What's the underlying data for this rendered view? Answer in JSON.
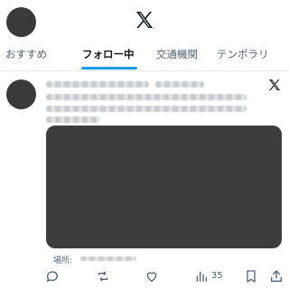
{
  "header": {
    "logo_icon": "x-logo-icon"
  },
  "tabs": [
    {
      "label": "おすすめ",
      "active": false
    },
    {
      "label": "フォロー中",
      "active": true
    },
    {
      "label": "交通機関",
      "active": false
    },
    {
      "label": "テンポラリ",
      "active": false
    }
  ],
  "post": {
    "location_label": "場所:",
    "actions": {
      "reply_icon": "comment-icon",
      "repost_icon": "repost-icon",
      "like_icon": "heart-icon",
      "views_icon": "views-chart-icon",
      "views_count": "35",
      "bookmark_icon": "bookmark-icon",
      "share_icon": "share-icon"
    }
  },
  "colors": {
    "accent": "#1d9bf0",
    "text_primary": "#0f1419",
    "text_secondary": "#536471",
    "media_placeholder": "#3d3d3d"
  }
}
